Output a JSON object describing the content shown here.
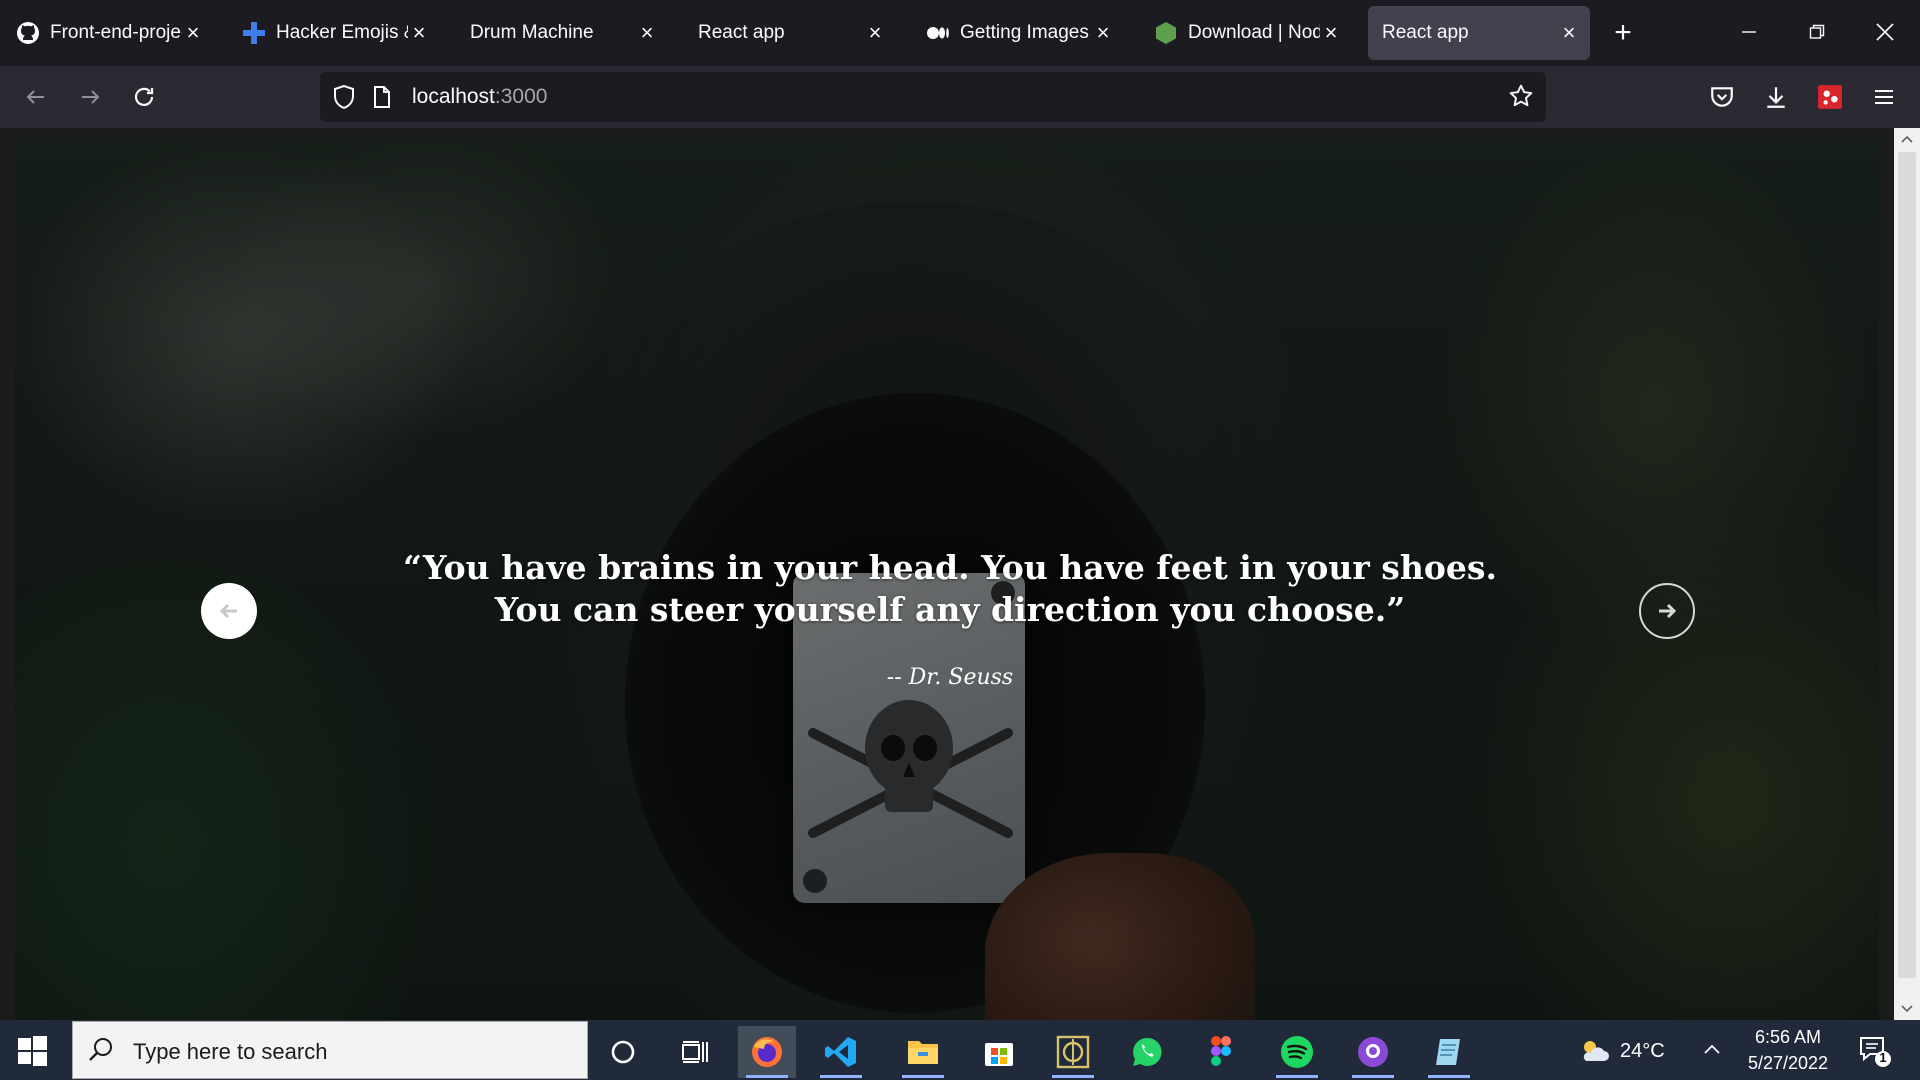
{
  "browser": {
    "tabs": [
      {
        "title": "Front-end-project",
        "icon": "github-icon",
        "active": false
      },
      {
        "title": "Hacker Emojis & T",
        "icon": "plus-emoji-icon",
        "active": false
      },
      {
        "title": "Drum Machine",
        "icon": "",
        "active": false
      },
      {
        "title": "React app",
        "icon": "",
        "active": false
      },
      {
        "title": "Getting Images in",
        "icon": "medium-icon",
        "active": false
      },
      {
        "title": "Download | Node",
        "icon": "nodejs-icon",
        "active": false
      },
      {
        "title": "React app",
        "icon": "",
        "active": true
      }
    ],
    "url_host": "localhost",
    "url_port": ":3000"
  },
  "page": {
    "quote": "“You have brains in your head. You have feet in your shoes. You can steer yourself any direction you choose.”",
    "author": "-- Dr. Seuss"
  },
  "taskbar": {
    "search_placeholder": "Type here to search",
    "weather_temp": "24°C",
    "time": "6:56 AM",
    "date": "5/27/2022",
    "notification_count": "1",
    "apps": [
      "cortana-icon",
      "task-view-icon",
      "firefox-icon",
      "vscode-icon",
      "file-explorer-icon",
      "microsoft-store-icon",
      "app-icon",
      "whatsapp-icon",
      "figma-icon",
      "spotify-icon",
      "github-desktop-icon",
      "notepad-icon"
    ]
  },
  "colors": {
    "tab_bg": "#1c1b22",
    "active_tab": "#42414d",
    "toolbar": "#2b2a33",
    "taskbar": "#202a3a"
  }
}
